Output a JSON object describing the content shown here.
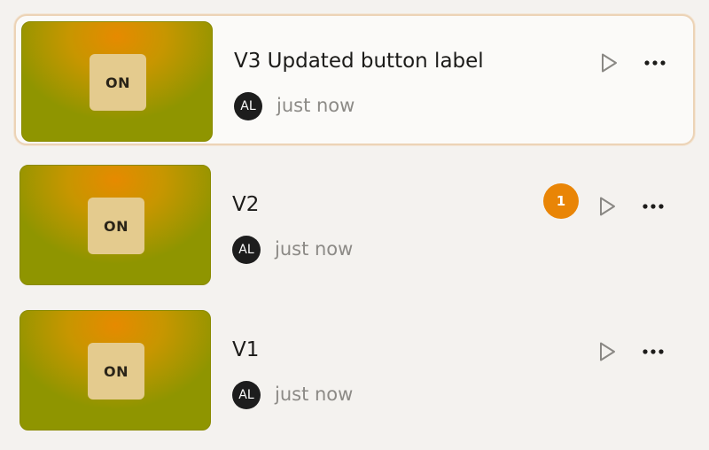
{
  "versions": [
    {
      "title": "V3 Updated button label",
      "thumbnail_label": "ON",
      "author_initials": "AL",
      "timestamp": "just now",
      "selected": true,
      "badge": ""
    },
    {
      "title": "V2",
      "thumbnail_label": "ON",
      "author_initials": "AL",
      "timestamp": "just now",
      "selected": false,
      "badge": "1"
    },
    {
      "title": "V1",
      "thumbnail_label": "ON",
      "author_initials": "AL",
      "timestamp": "just now",
      "selected": false,
      "badge": ""
    }
  ],
  "icons": {
    "play": "play-icon",
    "more": "more-horizontal-icon"
  },
  "colors": {
    "background": "#f4f2ef",
    "selected_border": "#ecd3b6",
    "badge": "#e98506",
    "avatar": "#1d1d1d",
    "thumbnail_chip": "#e4cb8e"
  }
}
